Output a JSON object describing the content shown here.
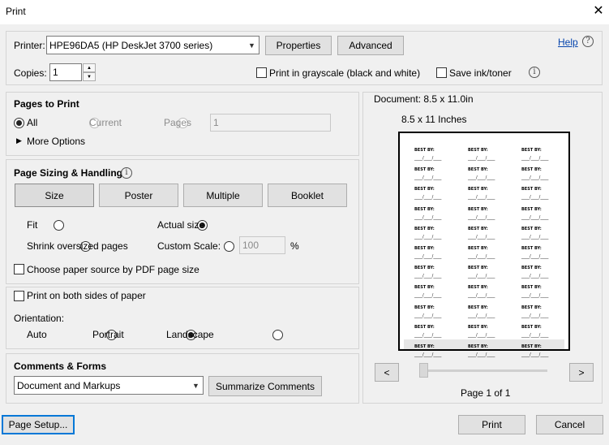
{
  "window": {
    "title": "Print"
  },
  "printer": {
    "label": "Printer:",
    "selected": "HPE96DA5 (HP DeskJet 3700 series)",
    "properties_label": "Properties",
    "advanced_label": "Advanced",
    "help_label": "Help"
  },
  "copies": {
    "label": "Copies:",
    "value": "1",
    "grayscale_label": "Print in grayscale (black and white)",
    "save_ink_label": "Save ink/toner"
  },
  "pages_to_print": {
    "heading": "Pages to Print",
    "all_label": "All",
    "current_label": "Current",
    "pages_label": "Pages",
    "pages_value": "1",
    "more_options_label": "More Options"
  },
  "sizing": {
    "heading": "Page Sizing & Handling",
    "tabs": [
      "Size",
      "Poster",
      "Multiple",
      "Booklet"
    ],
    "fit_label": "Fit",
    "actual_size_label": "Actual size",
    "shrink_label": "Shrink oversized pages",
    "custom_scale_label": "Custom Scale:",
    "custom_scale_value": "100",
    "percent_label": "%",
    "paper_source_label": "Choose paper source by PDF page size"
  },
  "duplex": {
    "both_sides_label": "Print on both sides of paper",
    "orientation_label": "Orientation:",
    "auto_label": "Auto",
    "portrait_label": "Portrait",
    "landscape_label": "Landscape"
  },
  "comments": {
    "heading": "Comments & Forms",
    "selected": "Document and Markups",
    "summarize_label": "Summarize Comments"
  },
  "preview": {
    "document_label": "Document: 8.5 x 11.0in",
    "paper_size_label": "8.5 x 11 Inches",
    "label_heading": "BEST BY:",
    "label_line": "____/____/____",
    "prev_label": "<",
    "next_label": ">",
    "page_indicator": "Page 1 of 1"
  },
  "footer": {
    "page_setup_label": "Page Setup...",
    "print_label": "Print",
    "cancel_label": "Cancel"
  }
}
